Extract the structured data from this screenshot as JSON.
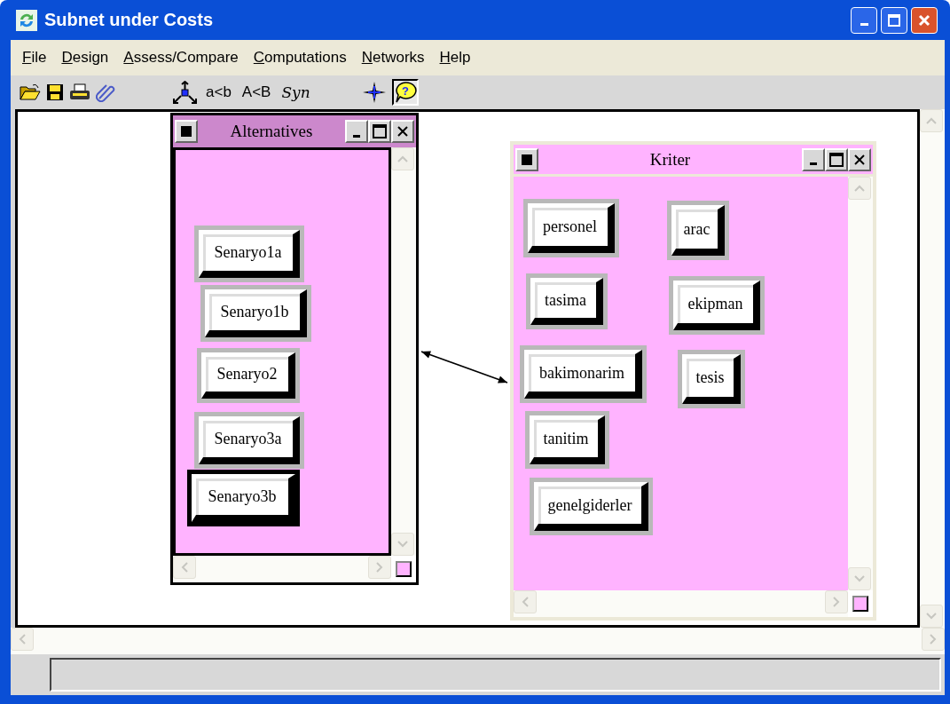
{
  "window": {
    "title": "Subnet under Costs"
  },
  "menu": [
    "File",
    "Design",
    "Assess/Compare",
    "Computations",
    "Networks",
    "Help"
  ],
  "toolbar": {
    "compare_buttons": [
      "a<b",
      "A<B",
      "Syn"
    ],
    "help_pressed": true,
    "help_glyph": "?"
  },
  "clusters": [
    {
      "title": "Alternatives",
      "active": true,
      "nodes": [
        {
          "label": "Senaryo1a",
          "selected": false
        },
        {
          "label": "Senaryo1b",
          "selected": false
        },
        {
          "label": "Senaryo2",
          "selected": false
        },
        {
          "label": "Senaryo3a",
          "selected": false
        },
        {
          "label": "Senaryo3b",
          "selected": true
        }
      ]
    },
    {
      "title": "Kriter",
      "active": false,
      "nodes": [
        {
          "label": "personel",
          "selected": false
        },
        {
          "label": "arac",
          "selected": false
        },
        {
          "label": "tasima",
          "selected": false
        },
        {
          "label": "ekipman",
          "selected": false
        },
        {
          "label": "bakimonarim",
          "selected": false
        },
        {
          "label": "tesis",
          "selected": false
        },
        {
          "label": "tanitim",
          "selected": false
        },
        {
          "label": "genelgiderler",
          "selected": false
        }
      ]
    }
  ],
  "link": {
    "bidirectional": true
  }
}
